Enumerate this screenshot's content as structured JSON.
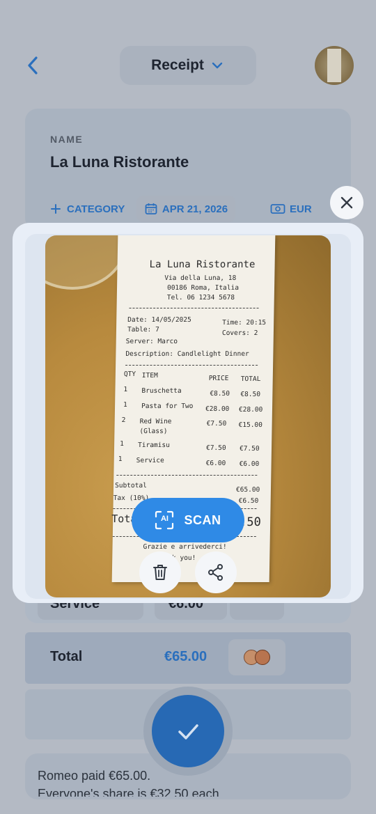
{
  "header": {
    "title": "Receipt",
    "back_icon": "chevron-left-icon",
    "dropdown_icon": "chevron-down-icon"
  },
  "form": {
    "name_label": "NAME",
    "name_value": "La Luna Ristorante",
    "category_label": "CATEGORY",
    "date_label": "APR 21, 2026",
    "currency_label": "EUR"
  },
  "rows": [
    {
      "item": "Service",
      "amount": "€6.00"
    }
  ],
  "total": {
    "label": "Total",
    "amount": "€65.00"
  },
  "summary": {
    "line1": "Romeo paid €65.00.",
    "line2": "Everyone's share is €32.50 each."
  },
  "overlay": {
    "scan_label": "SCAN",
    "ai_badge": "AI"
  },
  "receipt": {
    "name": "La Luna Ristorante",
    "address1": "Via della Luna, 18",
    "address2": "00186 Roma, Italia",
    "tel": "Tel. 06 1234 5678",
    "date": "Date:   14/05/2025",
    "time": "Time: 20:15",
    "table": "Table:  7",
    "covers": "Covers: 2",
    "server": "Server:  Marco",
    "description": "Description: Candlelight Dinner",
    "headers": {
      "qty": "QTY",
      "item": "ITEM",
      "price": "PRICE",
      "total": "TOTAL"
    },
    "items": [
      {
        "qty": "1",
        "item": "Bruschetta",
        "price": "€8.50",
        "total": "€8.50"
      },
      {
        "qty": "1",
        "item": "Pasta for Two",
        "price": "€28.00",
        "total": "€28.00"
      },
      {
        "qty": "2",
        "item": "Red Wine",
        "item2": "(Glass)",
        "price": "€7.50",
        "total": "€15.00"
      },
      {
        "qty": "1",
        "item": "Tiramisu",
        "price": "€7.50",
        "total": "€7.50"
      },
      {
        "qty": "1",
        "item": "Service",
        "price": "€6.00",
        "total": "€6.00"
      }
    ],
    "subtotal_label": "Subtotal",
    "subtotal": "€65.00",
    "tax_label": "Tax (10%)",
    "tax": "€6.50",
    "total_label": "Tota",
    "total": ".50",
    "footer1": "Grazie e arrivederci!",
    "footer2": "nk you!"
  },
  "colors": {
    "accent": "#2a6fbd",
    "scan_button": "#2f8ae6",
    "panel": "#e8eef7"
  }
}
